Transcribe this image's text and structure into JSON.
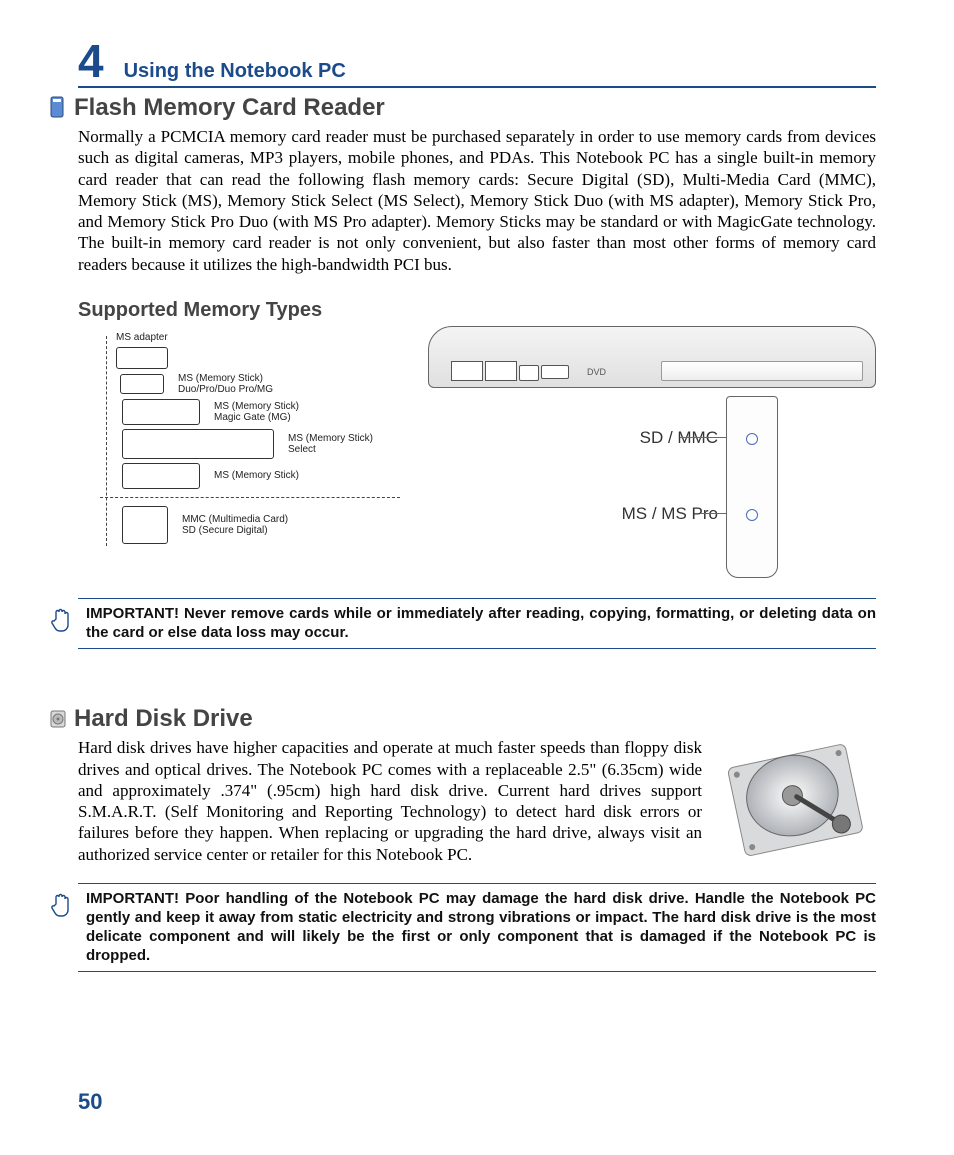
{
  "chapter": {
    "number": "4",
    "title": "Using the Notebook PC"
  },
  "section1": {
    "title": "Flash Memory Card Reader",
    "body": "Normally a PCMCIA memory card reader must be purchased separately in order to use memory cards from devices such as digital cameras, MP3 players, mobile phones, and PDAs. This Notebook PC has a single built-in memory card reader that can read the following flash memory cards: Secure Digital (SD), Multi-Media Card (MMC), Memory Stick (MS), Memory Stick Select (MS Select), Memory Stick Duo (with MS adapter), Memory Stick Pro, and Memory Stick Pro Duo (with MS Pro adapter). Memory Sticks may be standard or with MagicGate technology. The built-in memory card reader is not only convenient, but also faster than most other forms of memory card readers because it utilizes the high-bandwidth PCI bus."
  },
  "subhead": "Supported Memory Types",
  "cards": {
    "adapter": "MS adapter",
    "duo": "MS (Memory Stick)\nDuo/Pro/Duo Pro/MG",
    "mg": "MS (Memory Stick)\nMagic Gate (MG)",
    "select": "MS (Memory Stick)\nSelect",
    "ms": "MS (Memory Stick)",
    "mmc": "MMC (Multimedia Card)\nSD (Secure Digital)"
  },
  "slots": {
    "sd": "SD / MMC",
    "ms": "MS / MS Pro",
    "dvd": "DVD"
  },
  "important1": "IMPORTANT!  Never remove cards while or immediately after reading, copying, formatting, or deleting data on the card or else data loss may occur.",
  "section2": {
    "title": "Hard Disk Drive",
    "body": "Hard disk drives have higher capacities and operate at much faster speeds than floppy disk drives and optical drives. The Notebook PC comes with a replaceable 2.5\" (6.35cm) wide and approximately .374\" (.95cm) high hard disk drive. Current hard drives support S.M.A.R.T. (Self Monitoring and Reporting Technology) to detect hard disk errors or failures before they happen. When replacing or upgrading the hard drive, always visit an authorized service center or retailer for this Notebook PC."
  },
  "important2": "IMPORTANT!  Poor handling of the Notebook PC may damage the hard disk drive. Handle the Notebook PC gently and keep it away from static electricity and strong vibrations or impact. The hard disk drive is the most delicate component and will likely be the first or only component that is damaged if the Notebook PC is dropped.",
  "page_number": "50"
}
